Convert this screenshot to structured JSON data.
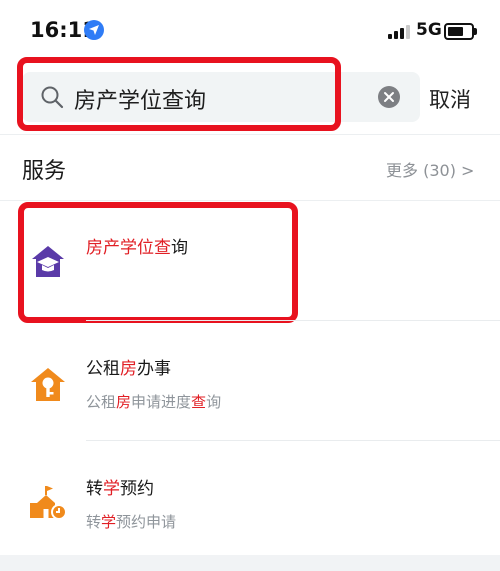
{
  "status_bar": {
    "time": "16:11",
    "network": "5G"
  },
  "search": {
    "query": "房产学位查询",
    "cancel_label": "取消"
  },
  "section": {
    "title": "服务",
    "more_label": "更多 (30) >"
  },
  "results": [
    {
      "title_parts": [
        "房产学位查",
        "询"
      ],
      "subtitle_parts": [],
      "icon": "graduation-house-icon",
      "icon_color": "#5a3aa8"
    },
    {
      "title_parts": [
        "公租",
        "房",
        "办事"
      ],
      "subtitle_parts": [
        "公租",
        "房",
        "申请进度",
        "查",
        "询"
      ],
      "icon": "house-key-icon",
      "icon_color": "#f08a1c"
    },
    {
      "title_parts": [
        "转",
        "学",
        "预约"
      ],
      "subtitle_parts": [
        "转",
        "学",
        "预约申请"
      ],
      "icon": "school-building-icon",
      "icon_color": "#f08a1c"
    }
  ],
  "colors": {
    "highlight": "#e11f25",
    "annotation_red": "#e8121f",
    "search_bg": "#f1f4f5"
  }
}
